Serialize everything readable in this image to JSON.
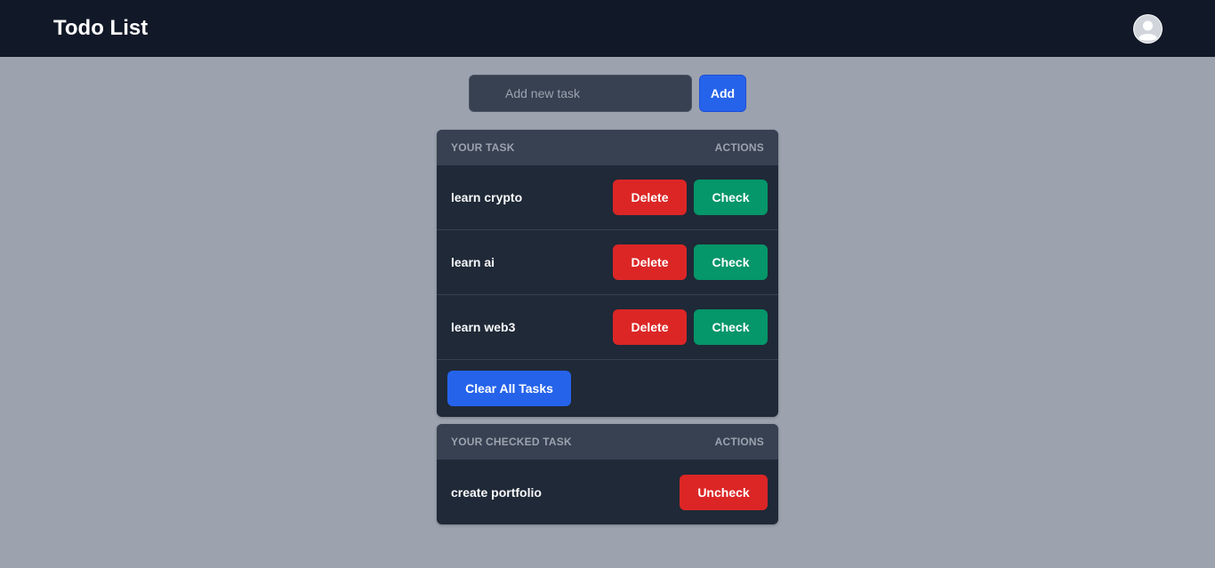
{
  "header": {
    "title": "Todo List",
    "avatar_icon": "user-avatar-icon"
  },
  "new_task": {
    "placeholder": "Add new task",
    "value": "",
    "add_label": "Add"
  },
  "tasks_panel": {
    "heading": "YOUR TASK",
    "actions_heading": "ACTIONS",
    "items": [
      {
        "label": "learn crypto",
        "delete_label": "Delete",
        "check_label": "Check"
      },
      {
        "label": "learn ai",
        "delete_label": "Delete",
        "check_label": "Check"
      },
      {
        "label": "learn web3",
        "delete_label": "Delete",
        "check_label": "Check"
      }
    ],
    "clear_label": "Clear All Tasks"
  },
  "checked_panel": {
    "heading": "YOUR CHECKED TASK",
    "actions_heading": "ACTIONS",
    "items": [
      {
        "label": "create portfolio",
        "uncheck_label": "Uncheck"
      }
    ]
  },
  "colors": {
    "navbar": "#111827",
    "page": "#9ca3af",
    "panel": "#1f2937",
    "delete": "#dc2626",
    "check": "#059669",
    "primary": "#2563eb"
  }
}
